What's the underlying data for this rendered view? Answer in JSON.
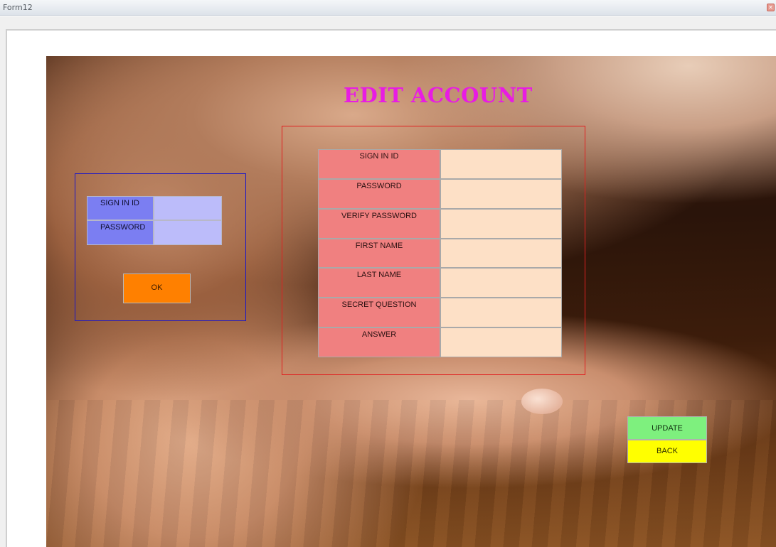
{
  "window": {
    "title": "Form12",
    "close_icon": "close-icon"
  },
  "form": {
    "heading": "EDIT ACCOUNT"
  },
  "login": {
    "sign_in_id_label": "SIGN IN ID",
    "sign_in_id_value": "",
    "password_label": "PASSWORD",
    "password_value": "",
    "ok_label": "OK"
  },
  "edit": {
    "fields": [
      {
        "label": "SIGN IN ID",
        "value": ""
      },
      {
        "label": "PASSWORD",
        "value": ""
      },
      {
        "label": "VERIFY PASSWORD",
        "value": ""
      },
      {
        "label": "FIRST NAME",
        "value": ""
      },
      {
        "label": "LAST NAME",
        "value": ""
      },
      {
        "label": "SECRET QUESTION",
        "value": ""
      },
      {
        "label": "ANSWER",
        "value": ""
      }
    ]
  },
  "actions": {
    "update_label": "UPDATE",
    "back_label": "BACK"
  },
  "colors": {
    "heading": "#e81ce3",
    "login_label_bg": "#7b7ef2",
    "login_input_bg": "#bcbcfa",
    "login_border": "#1c17c7",
    "ok_button": "#ff8000",
    "edit_label_bg": "#f08080",
    "edit_input_bg": "#fde0c6",
    "edit_border": "#e02020",
    "update_button": "#7ef07e",
    "back_button": "#ffff00"
  }
}
